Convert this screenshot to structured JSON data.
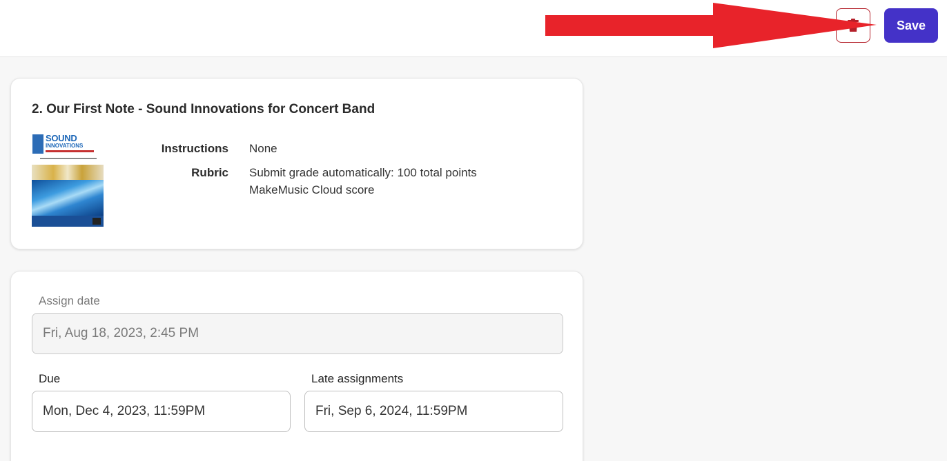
{
  "header": {
    "delete_icon": "trash-icon",
    "save_label": "Save",
    "accent_color": "#4432c8",
    "annotation_arrow_color": "#e8232a"
  },
  "assignment_card": {
    "title": "2. Our First Note - Sound Innovations for Concert Band",
    "cover": {
      "logo_line1": "SOUND",
      "logo_line2": "INNOVATIONS"
    },
    "instructions_label": "Instructions",
    "instructions_value": "None",
    "rubric_label": "Rubric",
    "rubric_line1": "Submit grade automatically: 100 total points",
    "rubric_line2": "MakeMusic Cloud score"
  },
  "dates_card": {
    "assign_label": "Assign date",
    "assign_value": "Fri, Aug 18, 2023, 2:45 PM",
    "due_label": "Due",
    "due_value": "Mon, Dec 4, 2023, 11:59PM",
    "late_label": "Late assignments",
    "late_value": "Fri, Sep 6, 2024, 11:59PM"
  }
}
